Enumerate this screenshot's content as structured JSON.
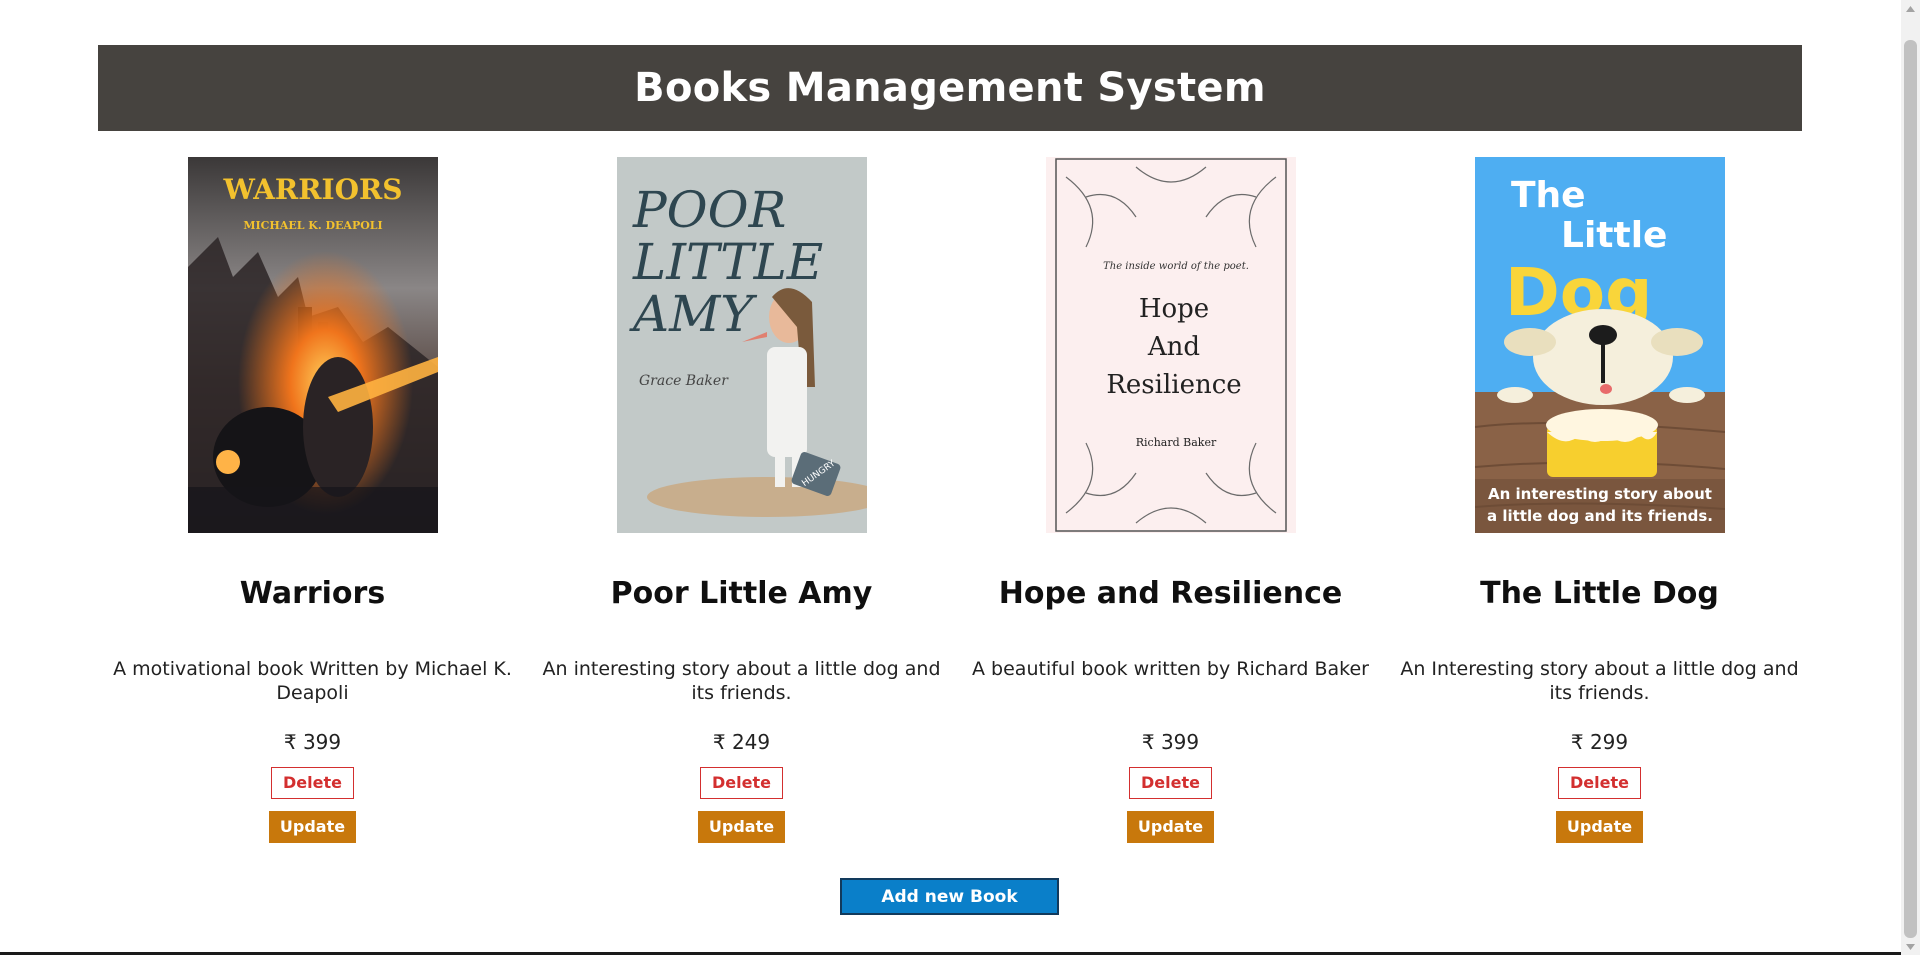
{
  "header": {
    "title": "Books Management System",
    "background": "#46433f"
  },
  "books": [
    {
      "title": "Warriors",
      "description": "A motivational book Written by Michael K. Deapoli",
      "price": "₹ 399",
      "cover_title": "WARRIORS",
      "cover_author": "MICHAEL K. DEAPOLI",
      "delete_label": "Delete",
      "update_label": "Update"
    },
    {
      "title": "Poor Little Amy",
      "description": "An interesting story about a little dog and its friends.",
      "price": "₹ 249",
      "cover_title_line1": "POOR",
      "cover_title_line2": "LITTLE",
      "cover_title_line3": "AMY",
      "cover_author": "Grace Baker",
      "cover_bag": "HUNGRY",
      "delete_label": "Delete",
      "update_label": "Update"
    },
    {
      "title": "Hope and Resilience",
      "description": "A beautiful book written by Richard Baker",
      "price": "₹ 399",
      "cover_tagline": "The inside world of the poet.",
      "cover_title_line1": "Hope",
      "cover_title_line2": "And",
      "cover_title_line3": "Resilience",
      "cover_author": "Richard Baker",
      "delete_label": "Delete",
      "update_label": "Update"
    },
    {
      "title": "The Little Dog",
      "description": "An Interesting story about a little dog and its friends.",
      "price": "₹ 299",
      "cover_title_line1": "The",
      "cover_title_line2": "Little",
      "cover_title_line3": "Dog",
      "cover_subtitle_line1": "An interesting story about",
      "cover_subtitle_line2": "a little dog and its friends.",
      "delete_label": "Delete",
      "update_label": "Update"
    }
  ],
  "add_button": {
    "label": "Add new Book",
    "color": "#0a7fc9"
  },
  "colors": {
    "delete": "#d32f2f",
    "update": "#c8780c"
  }
}
